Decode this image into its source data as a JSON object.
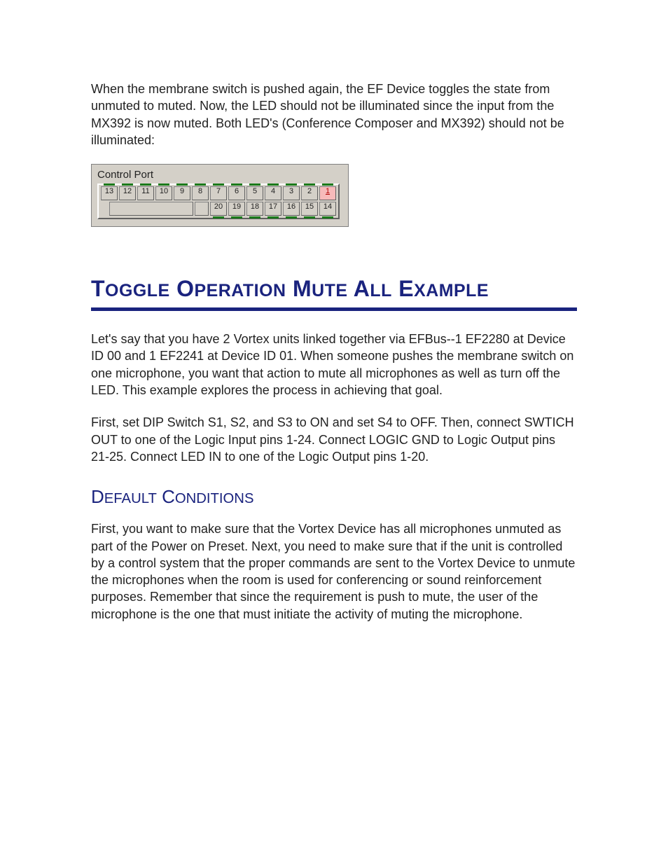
{
  "intro_paragraph": "When the membrane switch is pushed again, the EF Device toggles the state from unmuted to muted.  Now, the LED should not be illuminated since the input from the MX392 is now muted.  Both LED's (Conference Composer and MX392) should not be illuminated:",
  "control_port": {
    "title": "Control Port",
    "top_row": [
      {
        "label": "13",
        "active": false
      },
      {
        "label": "12",
        "active": false
      },
      {
        "label": "11",
        "active": false
      },
      {
        "label": "10",
        "active": false
      },
      {
        "label": "9",
        "active": false
      },
      {
        "label": "8",
        "active": false
      },
      {
        "label": "7",
        "active": false
      },
      {
        "label": "6",
        "active": false
      },
      {
        "label": "5",
        "active": false
      },
      {
        "label": "4",
        "active": false
      },
      {
        "label": "3",
        "active": false
      },
      {
        "label": "2",
        "active": false
      },
      {
        "label": "1",
        "active": true
      }
    ],
    "bottom_row": [
      {
        "label": "20",
        "active": false
      },
      {
        "label": "19",
        "active": false
      },
      {
        "label": "18",
        "active": false
      },
      {
        "label": "17",
        "active": false
      },
      {
        "label": "16",
        "active": false
      },
      {
        "label": "15",
        "active": false
      },
      {
        "label": "14",
        "active": false
      }
    ]
  },
  "headings": {
    "main": "Toggle Operation Mute All Example",
    "default_conditions": "Default Conditions"
  },
  "section_paragraphs": {
    "p1": "Let's say that you have 2 Vortex units linked together via EFBus--1 EF2280 at Device ID 00 and 1 EF2241 at Device ID 01.  When someone pushes the membrane switch on one microphone, you want that action to mute all microphones as well as turn off the LED.  This example explores the process in achieving that goal.",
    "p2": "First, set DIP Switch S1, S2, and S3 to ON and set S4 to OFF.  Then, connect SWTICH OUT to one of the Logic Input pins 1-24.  Connect LOGIC GND to Logic Output pins 21-25.  Connect LED IN to one of the Logic Output pins 1-20.",
    "default_conditions": "First, you want to make sure that the Vortex Device has all microphones unmuted as part of the Power on Preset.  Next, you need to make sure that if the unit is controlled by a control system that the proper commands are sent to the Vortex Device to unmute the microphones when the room is used for conferencing or sound reinforcement purposes.  Remember that since the requirement is push to mute, the user of the microphone is the one that must initiate the activity of muting the microphone."
  }
}
